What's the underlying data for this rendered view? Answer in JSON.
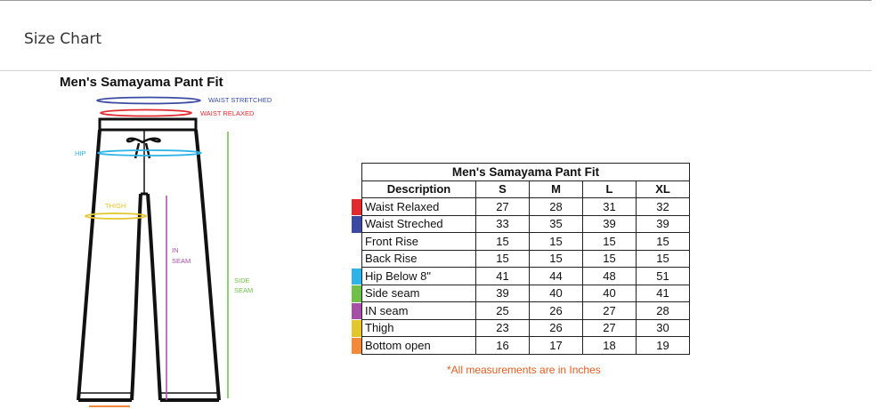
{
  "header": {
    "title": "Size Chart"
  },
  "figure": {
    "title": "Men's Samayama Pant Fit",
    "labels": {
      "waist_stretched": "WAIST STRETCHED",
      "waist_relaxed": "WAIST RELAXED",
      "hip": "HIP",
      "thigh": "THIGH",
      "in_seam_1": "IN",
      "in_seam_2": "SEAM",
      "side_seam_1": "SIDE",
      "side_seam_2": "SEAM"
    },
    "colors": {
      "waist_stretched": "#3b4aa0",
      "waist_relaxed": "#e2292e",
      "hip": "#2eb3e6",
      "thigh": "#e3c62a",
      "in_seam": "#a64fa6",
      "side_seam": "#6fbf49",
      "bottom": "#f28a3a"
    }
  },
  "table": {
    "title": "Men's Samayama Pant Fit",
    "headers": [
      "Description",
      "S",
      "M",
      "L",
      "XL"
    ],
    "rows": [
      {
        "label": "Waist Relaxed",
        "values": [
          "27",
          "28",
          "31",
          "32"
        ],
        "color": "#e2292e"
      },
      {
        "label": "Waist Streched",
        "values": [
          "33",
          "35",
          "39",
          "39"
        ],
        "color": "#3b4aa0"
      },
      {
        "label": "Front Rise",
        "values": [
          "15",
          "15",
          "15",
          "15"
        ],
        "color": ""
      },
      {
        "label": "Back Rise",
        "values": [
          "15",
          "15",
          "15",
          "15"
        ],
        "color": ""
      },
      {
        "label": "Hip Below 8\"",
        "values": [
          "41",
          "44",
          "48",
          "51"
        ],
        "color": "#2eb3e6"
      },
      {
        "label": "Side seam",
        "values": [
          "39",
          "40",
          "40",
          "41"
        ],
        "color": "#6fbf49"
      },
      {
        "label": "IN seam",
        "values": [
          "25",
          "26",
          "27",
          "28"
        ],
        "color": "#a64fa6"
      },
      {
        "label": "Thigh",
        "values": [
          "23",
          "26",
          "27",
          "30"
        ],
        "color": "#e3c62a"
      },
      {
        "label": "Bottom open",
        "values": [
          "16",
          "17",
          "18",
          "19"
        ],
        "color": "#f28a3a"
      }
    ]
  },
  "note": "*All measurements are in Inches"
}
